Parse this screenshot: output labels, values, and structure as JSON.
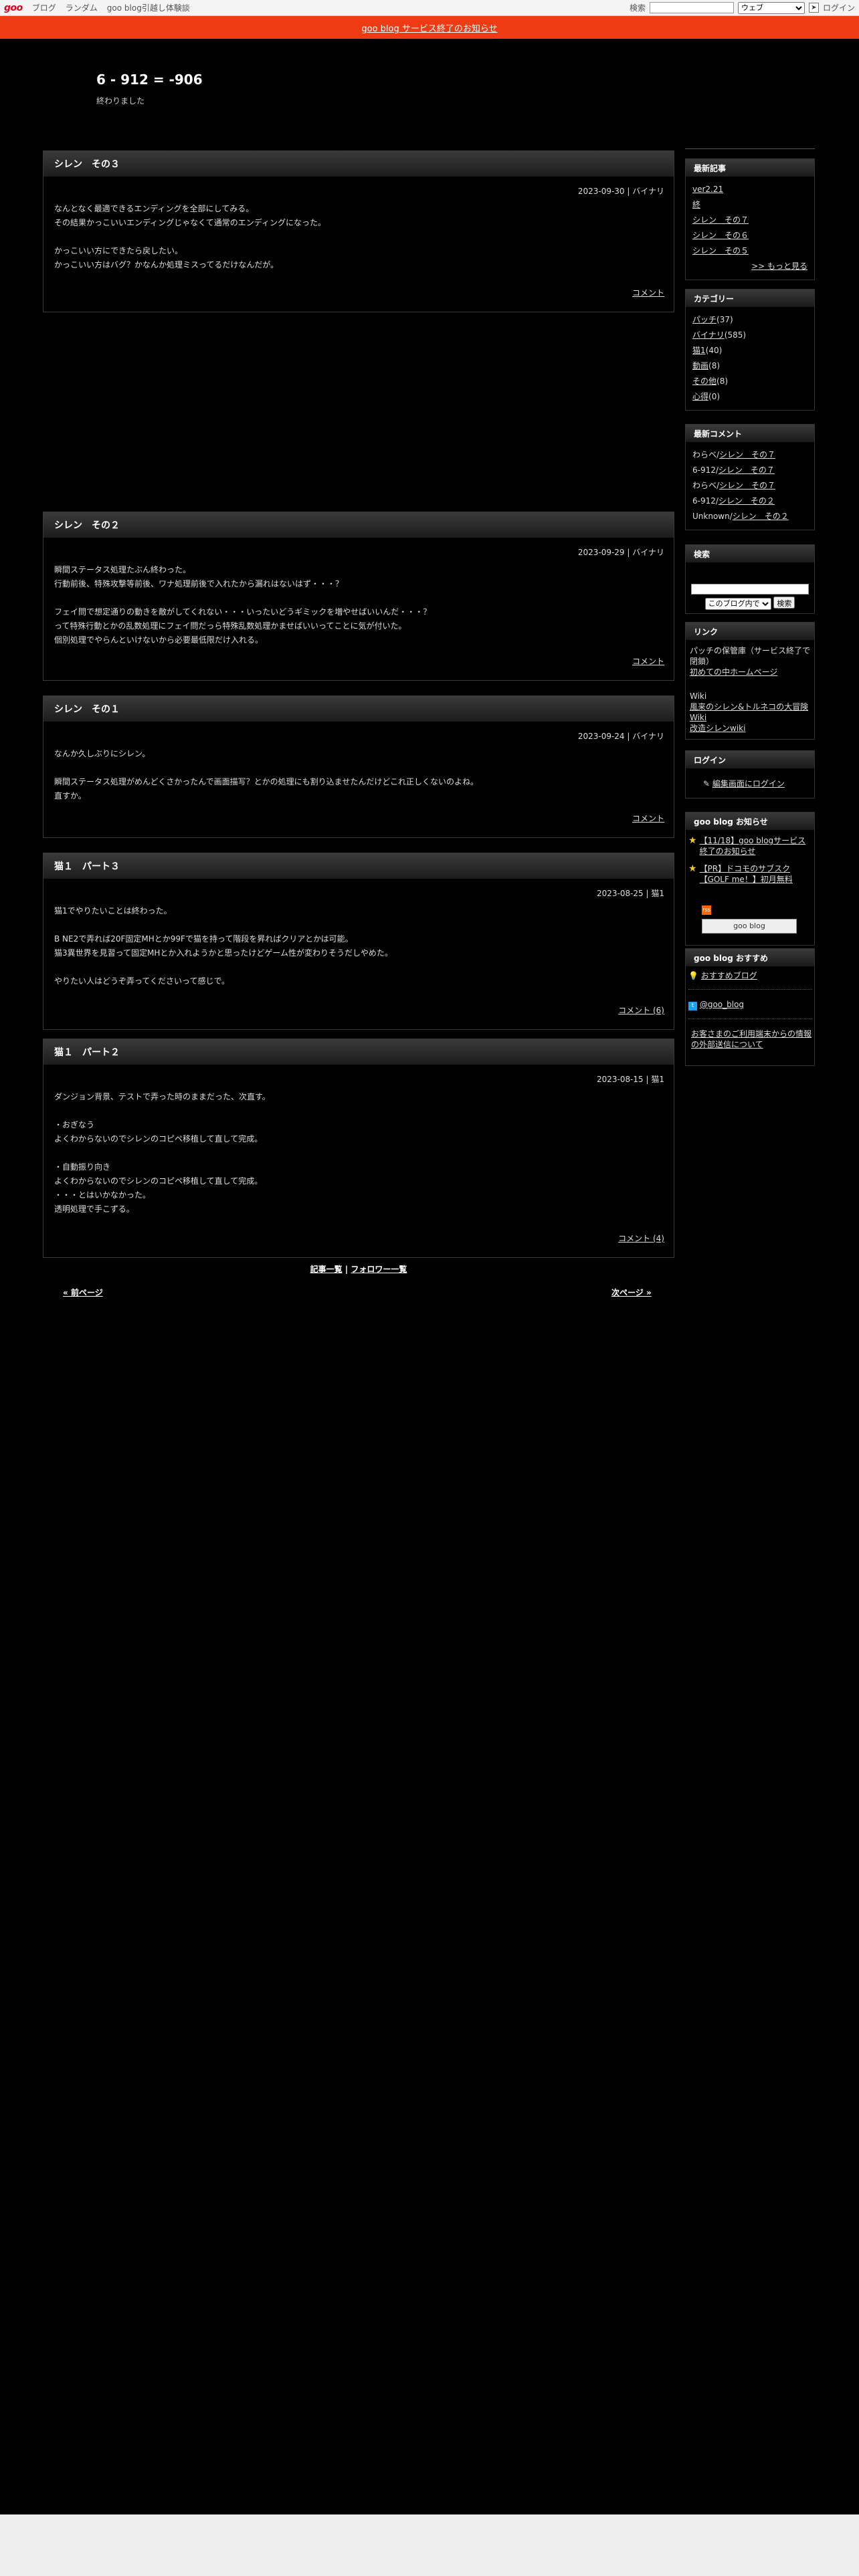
{
  "topbar": {
    "logo": "goo",
    "links": [
      "ブログ",
      "ランダム",
      "goo blog引越し体験談"
    ],
    "search_label": "検索",
    "search_value": "",
    "search_scope": "ウェブ",
    "login": "ログイン"
  },
  "notice": "goo blog サービス終了のお知らせ",
  "blog": {
    "title": "6 - 912 = -906",
    "subtitle": "終わりました"
  },
  "posts": [
    {
      "title": "シレン　その３",
      "meta": "2023-09-30 | バイナリ",
      "lines": [
        "なんとなく最適できるエンディングを全部にしてみる。",
        "その結果かっこいいエンディングじゃなくて通常のエンディングになった。",
        "",
        "かっこいい方にできたら戻したい。",
        "かっこいい方はバグ？かなんか処理ミスってるだけなんだが。"
      ],
      "comments": "コメント"
    },
    {
      "title": "シレン　その２",
      "meta": "2023-09-29 | バイナリ",
      "lines": [
        "瞬間ステータス処理たぶん終わった。",
        "行動前後、特殊攻撃等前後、ワナ処理前後で入れたから漏れはないはず・・・？",
        "",
        "フェイ問で想定通りの動きを敵がしてくれない・・・いったいどうギミックを増やせばいいんだ・・・？",
        "って特殊行動とかの乱数処理にフェイ問だっら特殊乱数処理かませばいいってことに気が付いた。",
        "個別処理でやらんといけないから必要最低限だけ入れる。"
      ],
      "comments": "コメント"
    },
    {
      "title": "シレン　その１",
      "meta": "2023-09-24 | バイナリ",
      "lines": [
        "なんか久しぶりにシレン。",
        "",
        "瞬間ステータス処理がめんどくさかったんで画面描写？とかの処理にも割り込ませたんだけどこれ正しくないのよね。",
        "直すか。"
      ],
      "comments": "コメント"
    },
    {
      "title": "猫１　パート３",
      "meta": "2023-08-25 | 猫1",
      "lines": [
        "猫1でやりたいことは終わった。",
        "",
        "B NE2で弄れば20F固定MHとか99Fで猫を持って階段を昇ればクリアとかは可能。",
        "猫3異世界を見習って固定MHとか入れようかと思ったけどゲーム性が変わりそうだしやめた。",
        "",
        "やりたい人はどうぞ弄ってくださいって感じで。"
      ],
      "comments": "コメント (6)"
    },
    {
      "title": "猫１　パート２",
      "meta": "2023-08-15 | 猫1",
      "lines": [
        "ダンジョン背景、テストで弄った時のままだった、次直す。",
        "",
        "・おぎなう",
        "よくわからないのでシレンのコピペ移植して直して完成。",
        "",
        "・自動振り向き",
        "よくわからないのでシレンのコピペ移植して直して完成。",
        "・・・とはいかなかった。",
        "透明処理で手こずる。"
      ],
      "comments": "コメント (4)"
    }
  ],
  "list_links": {
    "entries": "記事一覧",
    "sep": " | ",
    "followers": "フォロワー一覧"
  },
  "pager": {
    "prev": "« 前ページ",
    "next": "次ページ »"
  },
  "sidebar": {
    "recent": {
      "title": "最新記事",
      "items": [
        "ver2.21",
        "終",
        "シレン　その７",
        "シレン　その６",
        "シレン　その５"
      ],
      "more": ">> もっと見る"
    },
    "category": {
      "title": "カテゴリー",
      "items": [
        {
          "name": "パッチ",
          "count": "(37)"
        },
        {
          "name": "バイナリ",
          "count": "(585)"
        },
        {
          "name": "猫1",
          "count": "(40)"
        },
        {
          "name": "動画",
          "count": "(8)"
        },
        {
          "name": "その他",
          "count": "(8)"
        },
        {
          "name": "心得",
          "count": "(0)"
        }
      ]
    },
    "comments": {
      "title": "最新コメント",
      "items": [
        {
          "who": "わらベ/",
          "post": "シレン　その７"
        },
        {
          "who": "6-912/",
          "post": "シレン　その７"
        },
        {
          "who": "わらベ/",
          "post": "シレン　その７"
        },
        {
          "who": "6-912/",
          "post": "シレン　その２"
        },
        {
          "who": "Unknown/",
          "post": "シレン　その２"
        }
      ]
    },
    "search": {
      "title": "検索",
      "scope": "このブログ内で",
      "button": "検索"
    },
    "links": {
      "title": "リンク",
      "desc": "パッチの保管庫（サービス終了で閉鎖）",
      "link1": "初めての中ホームページ",
      "wiki": "Wiki",
      "link2": "風来のシレン&トルネコの大冒険 Wiki",
      "link3": "改造シレンwiki"
    },
    "login": {
      "title": "ログイン",
      "link": "編集画面にログイン"
    },
    "goonews": {
      "title": "goo blog お知らせ",
      "items": [
        "【11/18】goo blogサービス終了のお知らせ",
        "【PR】ドコモのサブスク【GOLF me！】初月無料"
      ]
    },
    "badge": {
      "rss": "rss",
      "logo": "goo blog"
    },
    "recommend": {
      "title": "goo blog おすすめ",
      "item": "おすすめブログ",
      "twitter": "@goo_blog",
      "notice": "お客さまのご利用端末からの情報の外部送信について"
    }
  }
}
